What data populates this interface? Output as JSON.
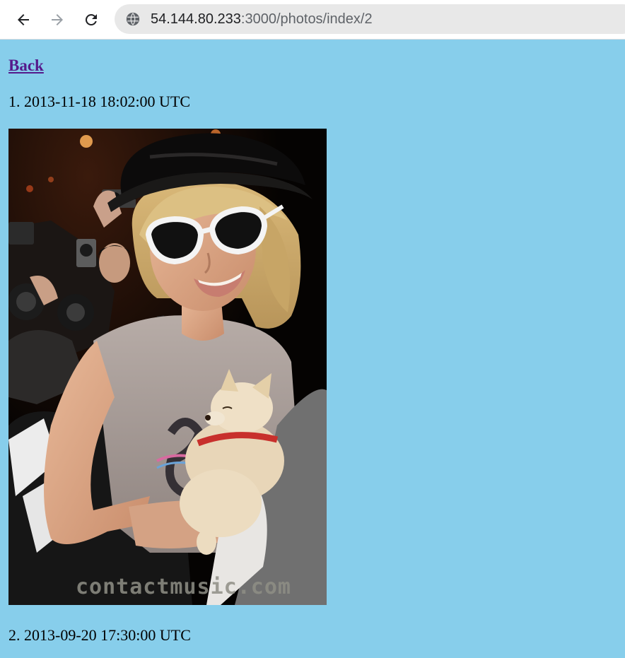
{
  "browser": {
    "url_host": "54.144.80.233",
    "url_path": ":3000/photos/index/2",
    "icons": {
      "back": "back-arrow-icon",
      "forward": "forward-arrow-icon",
      "reload": "reload-icon",
      "site": "site-info-icon"
    }
  },
  "page": {
    "back_label": "Back",
    "entries": [
      {
        "label": "1. 2013-11-18 18:02:00 UTC",
        "watermark": "contactmusic.com"
      },
      {
        "label": "2. 2013-09-20 17:30:00 UTC"
      }
    ]
  },
  "colors": {
    "page_background": "#87ceeb",
    "link": "#551a8b"
  }
}
